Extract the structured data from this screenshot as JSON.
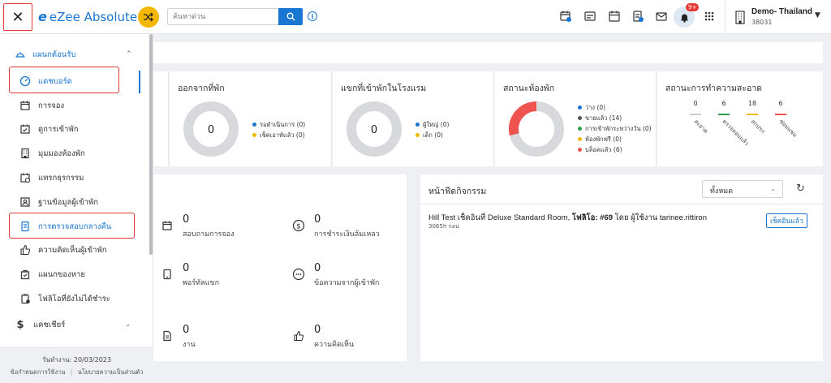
{
  "header": {
    "logo_text": "eZee Absolute",
    "search_placeholder": "ค้นหาด่วน",
    "notification_badge": "9+",
    "property_name": "Demo- Thailand",
    "property_id": "38031"
  },
  "sidebar": {
    "section_label": "แผนกต้อนรับ",
    "items": [
      {
        "label": "แดชบอร์ด",
        "icon": "dashboard-icon"
      },
      {
        "label": "การจอง",
        "icon": "calendar-icon"
      },
      {
        "label": "ดูการเข้าพัก",
        "icon": "stay-view-icon"
      },
      {
        "label": "มุมมองห้องพัก",
        "icon": "room-view-icon"
      },
      {
        "label": "แทรกธุรกรรม",
        "icon": "transaction-icon"
      },
      {
        "label": "ฐานข้อมูลผู้เข้าพัก",
        "icon": "guest-database-icon"
      },
      {
        "label": "การตรวจสอบกลางคืน",
        "icon": "night-audit-icon"
      },
      {
        "label": "ความคิดเห็นผู้เข้าพัก",
        "icon": "thumbs-up-icon"
      },
      {
        "label": "แผนกของหาย",
        "icon": "lost-found-icon"
      },
      {
        "label": "โฟลิโอที่ยังไม่ได้ชำระ",
        "icon": "clipboard-icon"
      }
    ],
    "cashier_label": "แคชเชียร์",
    "footer_date": "วันทำงาน: 20/03/2023",
    "footer_link1": "ข้อกำหนดการใช้งาน",
    "footer_link2": "นโยบายความเป็นส่วนตัว"
  },
  "cards": {
    "departure": {
      "title": "ออกจากที่พัก",
      "value": "0",
      "legend": [
        {
          "label": "รอดำเนินการ (0)",
          "color": "#1976d2"
        },
        {
          "label": "เช็คเอาท์แล้ว (0)",
          "color": "#f5b700"
        }
      ]
    },
    "inhouse": {
      "title": "แขกที่เข้าพักในโรงแรม",
      "value": "0",
      "legend": [
        {
          "label": "ผู้ใหญ่ (0)",
          "color": "#1976d2"
        },
        {
          "label": "เด็ก (0)",
          "color": "#f5b700"
        }
      ]
    },
    "room_status": {
      "title": "สถานะห้องพัก",
      "legend": [
        {
          "label": "ว่าง (0)",
          "color": "#1976d2"
        },
        {
          "label": "ขายแล้ว (14)",
          "color": "#555555"
        },
        {
          "label": "การเข้าพักระหว่างวัน (0)",
          "color": "#2e9e4a"
        },
        {
          "label": "ห้องพักฟรี (0)",
          "color": "#f5b700"
        },
        {
          "label": "บล็อคแล้ว (6)",
          "color": "#ef5350"
        }
      ]
    },
    "housekeeping": {
      "title": "สถานะการทำความสะอาด"
    }
  },
  "chart_data": {
    "type": "bar",
    "categories": [
      "สะอาด",
      "ตรวจสอบแล้ว",
      "สกปรก",
      "ซ่อมแซม"
    ],
    "values": [
      0,
      6,
      18,
      6
    ],
    "colors": [
      "#cccccc",
      "#2e9e4a",
      "#f5b700",
      "#ef5350"
    ],
    "title": "สถานะการทำความสะอาด"
  },
  "lower_left": {
    "items": [
      {
        "value": "0",
        "label": "สอบถามการจอง",
        "icon": "calendar-icon"
      },
      {
        "value": "0",
        "label": "การชำระเงินล้มเหลว",
        "icon": "dollar-icon"
      },
      {
        "value": "0",
        "label": "พอร์ทัลแขก",
        "icon": "tablet-icon"
      },
      {
        "value": "0",
        "label": "ข้อความจากผู้เข้าพัก",
        "icon": "chat-icon"
      },
      {
        "value": "0",
        "label": "งาน",
        "icon": "task-icon"
      },
      {
        "value": "0",
        "label": "ความคิดเห็น",
        "icon": "thumbs-up-icon"
      }
    ]
  },
  "activity": {
    "title": "หน้าฟีดกิจกรรม",
    "filter_value": "ทั้งหมด",
    "entry_prefix": "Hill Test เช็คอินที่ Deluxe Standard Room, ",
    "entry_bold": "โฟลิโอ: #69",
    "entry_suffix": " โดย ผู้ใช้งาน tarinee.rittiron",
    "entry_time": "3065h ก่อน",
    "entry_badge": "เช็คอินแล้ว"
  }
}
